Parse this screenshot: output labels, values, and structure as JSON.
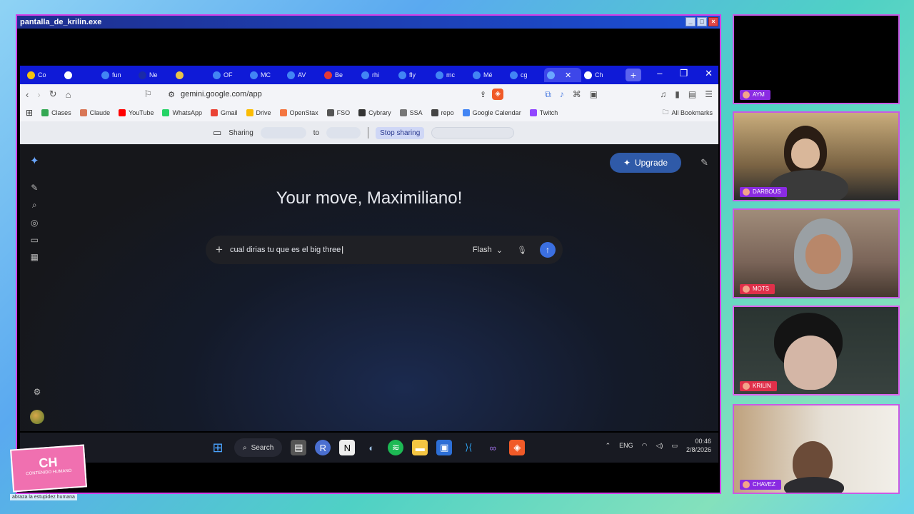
{
  "window": {
    "title": "pantalla_de_krilin.exe"
  },
  "browser": {
    "tabs": [
      {
        "label": "Co",
        "color": "#f4c20d"
      },
      {
        "label": "",
        "color": "#ffffff"
      },
      {
        "label": "fun",
        "color": "#4285f4"
      },
      {
        "label": "Ne",
        "color": "#1a2aa8"
      },
      {
        "label": "",
        "color": "#e8c44a"
      },
      {
        "label": "OF",
        "color": "#4285f4"
      },
      {
        "label": "MC",
        "color": "#4285f4"
      },
      {
        "label": "AV",
        "color": "#4285f4"
      },
      {
        "label": "Be",
        "color": "#e53935"
      },
      {
        "label": "rhi",
        "color": "#4285f4"
      },
      {
        "label": "fly",
        "color": "#4285f4"
      },
      {
        "label": "mc",
        "color": "#4285f4"
      },
      {
        "label": "Mé",
        "color": "#4285f4"
      },
      {
        "label": "cg",
        "color": "#4285f4"
      },
      {
        "label": "",
        "color": "#6aa7ff",
        "active": true
      },
      {
        "label": "Ch",
        "color": "#ffffff"
      }
    ],
    "url": "gemini.google.com/app",
    "bookmarks": [
      {
        "label": "Clases",
        "color": "#34a853"
      },
      {
        "label": "Claude",
        "color": "#d97757"
      },
      {
        "label": "YouTube",
        "color": "#ff0000"
      },
      {
        "label": "WhatsApp",
        "color": "#25d366"
      },
      {
        "label": "Gmail",
        "color": "#ea4335"
      },
      {
        "label": "Drive",
        "color": "#fbbc04"
      },
      {
        "label": "OpenStax",
        "color": "#f47641"
      },
      {
        "label": "FSO",
        "color": "#555555"
      },
      {
        "label": "Cybrary",
        "color": "#333333"
      },
      {
        "label": "SSA",
        "color": "#777777"
      },
      {
        "label": "repo",
        "color": "#444444"
      },
      {
        "label": "Google Calendar",
        "color": "#4285f4"
      },
      {
        "label": "Twitch",
        "color": "#9146ff"
      }
    ],
    "all_bookmarks": "All Bookmarks",
    "share": {
      "sharing": "Sharing",
      "to": "to",
      "stop": "Stop sharing"
    }
  },
  "gemini": {
    "upgrade": "Upgrade",
    "greeting": "Your move, Maximiliano!",
    "prompt_text": "cual dirias tu que es el big three",
    "model": "Flash"
  },
  "taskbar": {
    "search": "Search",
    "lang": "ENG",
    "time": "00:46",
    "date": "2/8/2026"
  },
  "cams": [
    {
      "name": "AYM",
      "label_color": "#8a2be2"
    },
    {
      "name": "DARBOUS",
      "label_color": "#8a2be2"
    },
    {
      "name": "MOTS",
      "label_color": "#e0304a"
    },
    {
      "name": "KRILIN",
      "label_color": "#e0304a"
    },
    {
      "name": "CHAVEZ",
      "label_color": "#8a2be2"
    }
  ],
  "logo": {
    "big": "CH",
    "small": "CONTENIDO HUMANO",
    "tagline": "abraza la estupidez humana"
  }
}
